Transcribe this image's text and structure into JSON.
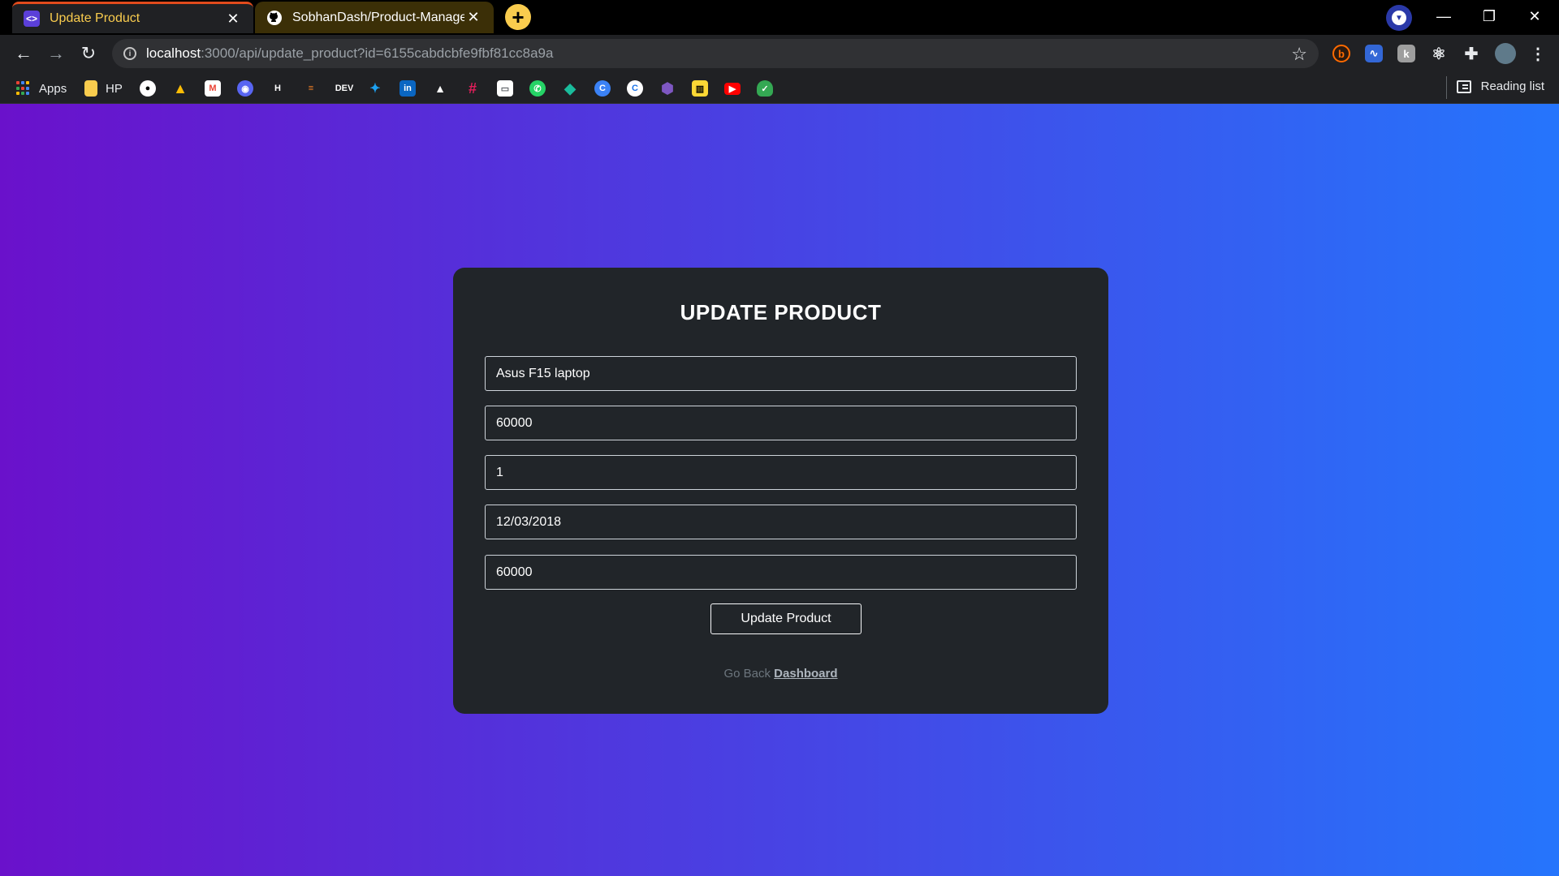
{
  "tabs": [
    {
      "title": "Update Product",
      "favicon": "app-code-icon",
      "active": true
    },
    {
      "title": "SobhanDash/Product-Management",
      "favicon": "github-icon",
      "active": false
    }
  ],
  "address_bar": {
    "host": "localhost",
    "path": ":3000/api/update_product?id=6155cabdcbfe9fbf81cc8a9a"
  },
  "bookmarks": [
    {
      "label": "Apps",
      "icon": "apps-grid-icon"
    },
    {
      "label": "HP",
      "icon": "folder-icon"
    },
    {
      "label": "",
      "icon": "github-icon"
    },
    {
      "label": "",
      "icon": "google-drive-icon"
    },
    {
      "label": "",
      "icon": "gmail-icon"
    },
    {
      "label": "",
      "icon": "discord-icon"
    },
    {
      "label": "",
      "icon": "hackerrank-icon"
    },
    {
      "label": "",
      "icon": "stackoverflow-icon"
    },
    {
      "label": "",
      "icon": "dev-icon"
    },
    {
      "label": "",
      "icon": "twitter-icon"
    },
    {
      "label": "",
      "icon": "linkedin-icon"
    },
    {
      "label": "",
      "icon": "vercel-icon"
    },
    {
      "label": "",
      "icon": "slack-icon"
    },
    {
      "label": "",
      "icon": "bookmark-page-icon"
    },
    {
      "label": "",
      "icon": "whatsapp-icon"
    },
    {
      "label": "",
      "icon": "diamond-icon"
    },
    {
      "label": "",
      "icon": "copyleaks-icon"
    },
    {
      "label": "",
      "icon": "c-circle-icon"
    },
    {
      "label": "",
      "icon": "hexagon-icon"
    },
    {
      "label": "",
      "icon": "trello-icon"
    },
    {
      "label": "",
      "icon": "youtube-icon"
    },
    {
      "label": "",
      "icon": "shield-icon"
    }
  ],
  "reading_list": "Reading list",
  "form": {
    "title": "UPDATE PRODUCT",
    "fields": [
      {
        "value": "Asus F15 laptop"
      },
      {
        "value": "60000"
      },
      {
        "value": "1"
      },
      {
        "value": "12/03/2018"
      },
      {
        "value": "60000"
      }
    ],
    "submit_label": "Update Product",
    "go_back_text": "Go Back",
    "dashboard_link": "Dashboard"
  },
  "colors": {
    "gradient_start": "#6a11cb",
    "gradient_end": "#2575fc",
    "card_bg": "#212529",
    "active_tab_text": "#f9cc4e"
  }
}
